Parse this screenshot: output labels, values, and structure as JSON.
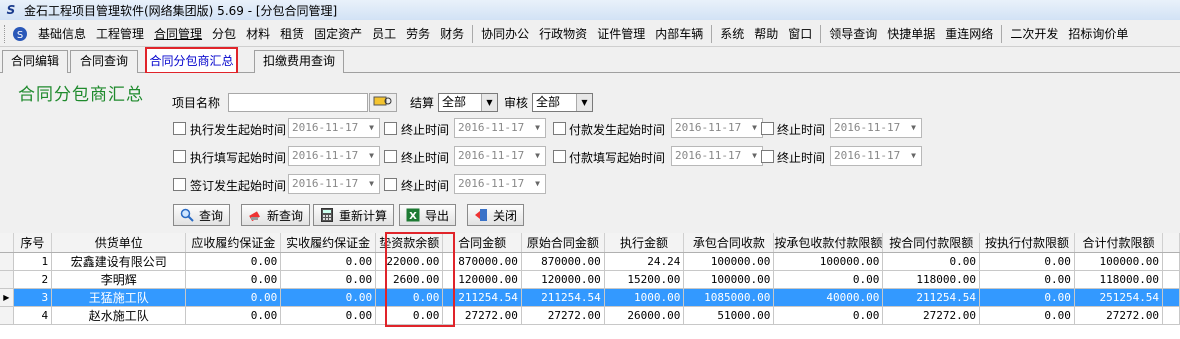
{
  "window": {
    "title": "金石工程项目管理软件(网络集团版) 5.69 - [分包合同管理]"
  },
  "menu": [
    "基础信息",
    "工程管理",
    "合同管理",
    "分包",
    "材料",
    "租赁",
    "固定资产",
    "员工",
    "劳务",
    "财务",
    "协同办公",
    "行政物资",
    "证件管理",
    "内部车辆",
    "系统",
    "帮助",
    "窗口",
    "领导查询",
    "快捷单据",
    "重连网络",
    "二次开发",
    "招标询价单"
  ],
  "tabs": [
    "合同编辑",
    "合同查询",
    "合同分包商汇总",
    "扣缴费用查询"
  ],
  "panel": {
    "title": "合同分包商汇总",
    "project_label": "项目名称",
    "settle_label": "结算",
    "settle_value": "全部",
    "audit_label": "审核",
    "audit_value": "全部",
    "date_value": "2016-11-17",
    "row1": {
      "a": "执行发生起始时间",
      "b": "终止时间",
      "c": "付款发生起始时间",
      "d": "终止时间"
    },
    "row2": {
      "a": "执行填写起始时间",
      "b": "终止时间",
      "c": "付款填写起始时间",
      "d": "终止时间"
    },
    "row3": {
      "a": "签订发生起始时间",
      "b": "终止时间"
    }
  },
  "buttons": {
    "query": "查询",
    "new_query": "新查询",
    "recalc": "重新计算",
    "export": "导出",
    "close": "关闭"
  },
  "grid": {
    "headers": [
      "序号",
      "供货单位",
      "应收履约保证金",
      "实收履约保证金",
      "垫资款余额",
      "合同金额",
      "原始合同金额",
      "执行金额",
      "承包合同收款",
      "按承包收款付款限额",
      "按合同付款限额",
      "按执行付款限额",
      "合计付款限额"
    ],
    "rows": [
      [
        "1",
        "宏鑫建设有限公司",
        "0.00",
        "0.00",
        "22000.00",
        "870000.00",
        "870000.00",
        "24.24",
        "100000.00",
        "100000.00",
        "0.00",
        "0.00",
        "100000.00"
      ],
      [
        "2",
        "李明辉",
        "0.00",
        "0.00",
        "2600.00",
        "120000.00",
        "120000.00",
        "15200.00",
        "100000.00",
        "0.00",
        "118000.00",
        "0.00",
        "118000.00"
      ],
      [
        "3",
        "王猛施工队",
        "0.00",
        "0.00",
        "0.00",
        "211254.54",
        "211254.54",
        "1000.00",
        "1085000.00",
        "40000.00",
        "211254.54",
        "0.00",
        "251254.54"
      ],
      [
        "4",
        "赵水施工队",
        "0.00",
        "0.00",
        "0.00",
        "27272.00",
        "27272.00",
        "26000.00",
        "51000.00",
        "0.00",
        "27272.00",
        "0.00",
        "27272.00"
      ]
    ],
    "selected_row": 2
  },
  "colors": {
    "accent": "#3399ff",
    "highlight": "#e0242a",
    "title_green": "#1f8a2d"
  }
}
